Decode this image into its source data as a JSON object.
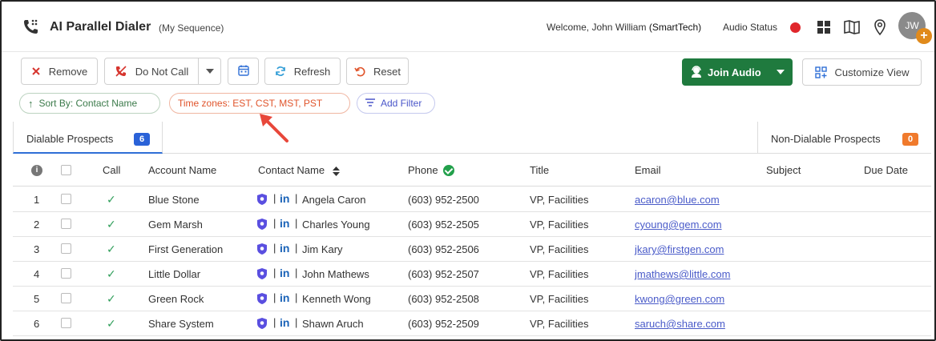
{
  "header": {
    "title": "AI Parallel Dialer",
    "subtitle": "(My Sequence)",
    "welcome_prefix": "Welcome, John William",
    "welcome_org": "(SmartTech)",
    "audio_status_label": "Audio Status",
    "audio_status_color": "#e0262b",
    "avatar_initials": "JW",
    "avatar_badge": "+",
    "icons": [
      "grid-icon",
      "book-icon",
      "location-pin-icon"
    ]
  },
  "toolbar": {
    "remove_label": "Remove",
    "dnc_label": "Do Not Call",
    "refresh_label": "Refresh",
    "reset_label": "Reset",
    "join_audio_label": "Join Audio",
    "customize_view_label": "Customize View"
  },
  "filters": {
    "sort_label": "Sort By: Contact Name",
    "timezone_label": "Time zones: EST, CST, MST, PST",
    "add_filter_label": "Add Filter"
  },
  "tabs": {
    "dialable_label": "Dialable Prospects",
    "dialable_count": "6",
    "nondialable_label": "Non-Dialable Prospects",
    "nondialable_count": "0"
  },
  "table": {
    "headers": {
      "call": "Call",
      "account": "Account Name",
      "contact": "Contact Name",
      "phone": "Phone",
      "title": "Title",
      "email": "Email",
      "subject": "Subject",
      "due": "Due Date"
    },
    "rows": [
      {
        "num": "1",
        "account": "Blue Stone",
        "contact": "Angela Caron",
        "phone": "(603) 952-2500",
        "title": "VP, Facilities",
        "email": "acaron@blue.com"
      },
      {
        "num": "2",
        "account": "Gem Marsh",
        "contact": "Charles Young",
        "phone": "(603) 952-2505",
        "title": "VP, Facilities",
        "email": "cyoung@gem.com"
      },
      {
        "num": "3",
        "account": "First Generation",
        "contact": "Jim Kary",
        "phone": "(603) 952-2506",
        "title": "VP, Facilities",
        "email": "jkary@firstgen.com"
      },
      {
        "num": "4",
        "account": "Little Dollar",
        "contact": "John Mathews",
        "phone": "(603) 952-2507",
        "title": "VP, Facilities",
        "email": "jmathews@little.com"
      },
      {
        "num": "5",
        "account": "Green Rock",
        "contact": "Kenneth Wong",
        "phone": "(603) 952-2508",
        "title": "VP, Facilities",
        "email": "kwong@green.com"
      },
      {
        "num": "6",
        "account": "Share System",
        "contact": "Shawn Aruch",
        "phone": "(603) 952-2509",
        "title": "VP, Facilities",
        "email": "saruch@share.com"
      }
    ]
  }
}
